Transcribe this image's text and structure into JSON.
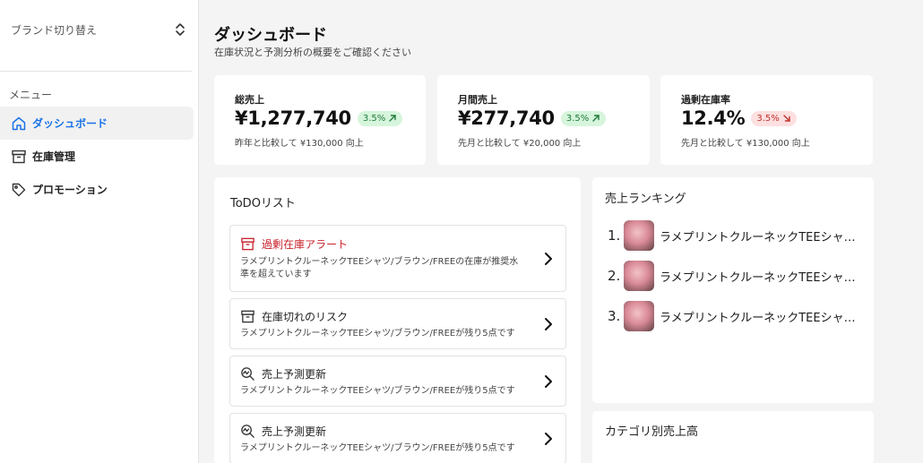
{
  "sidebar": {
    "brand_switch_label": "ブランド切り替え",
    "menu_heading": "メニュー",
    "items": [
      {
        "label": "ダッシュボード",
        "icon": "home-icon",
        "active": true
      },
      {
        "label": "在庫管理",
        "icon": "archive-icon",
        "active": false
      },
      {
        "label": "プロモーション",
        "icon": "tag-icon",
        "active": false
      }
    ]
  },
  "header": {
    "title": "ダッシュボード",
    "subtitle": "在庫状況と予測分析の概要をご確認ください"
  },
  "kpis": [
    {
      "label": "総売上",
      "value": "¥1,277,740",
      "badge": "3.5%",
      "trend": "up",
      "note": "昨年と比較して ¥130,000 向上"
    },
    {
      "label": "月間売上",
      "value": "¥277,740",
      "badge": "3.5%",
      "trend": "up",
      "note": "先月と比較して ¥20,000 向上"
    },
    {
      "label": "過剰在庫率",
      "value": "12.4%",
      "badge": "3.5%",
      "trend": "down",
      "note": "先月と比較して ¥130,000 向上"
    }
  ],
  "todo": {
    "title": "ToDOリスト",
    "items": [
      {
        "title": "過剰在庫アラート",
        "icon": "archive-icon",
        "alert": true,
        "desc": "ラメプリントクルーネックTEEシャツ/ブラウン/FREEの在庫が推奨水準を超えています"
      },
      {
        "title": "在庫切れのリスク",
        "icon": "archive-icon",
        "alert": false,
        "desc": "ラメプリントクルーネックTEEシャツ/ブラウン/FREEが残り5点です"
      },
      {
        "title": "売上予測更新",
        "icon": "search-chart-icon",
        "alert": false,
        "desc": "ラメプリントクルーネックTEEシャツ/ブラウン/FREEが残り5点です"
      },
      {
        "title": "売上予測更新",
        "icon": "search-chart-icon",
        "alert": false,
        "desc": "ラメプリントクルーネックTEEシャツ/ブラウン/FREEが残り5点です"
      }
    ]
  },
  "ranking": {
    "title": "売上ランキング",
    "items": [
      {
        "rank": "1.",
        "name": "ラメプリントクルーネックTEEシャツ/ブラウン/FREE"
      },
      {
        "rank": "2.",
        "name": "ラメプリントクルーネックTEEシャツ/ブラウン/FREE"
      },
      {
        "rank": "3.",
        "name": "ラメプリントクルーネックTEEシャツ/ブラウン/FREE"
      }
    ]
  },
  "category_sales": {
    "title": "カテゴリ別売上高"
  },
  "colors": {
    "accent": "#1a73e8",
    "alert": "#c8232c",
    "badge_up_bg": "#d6f5dc",
    "badge_down_bg": "#fde0e0"
  }
}
